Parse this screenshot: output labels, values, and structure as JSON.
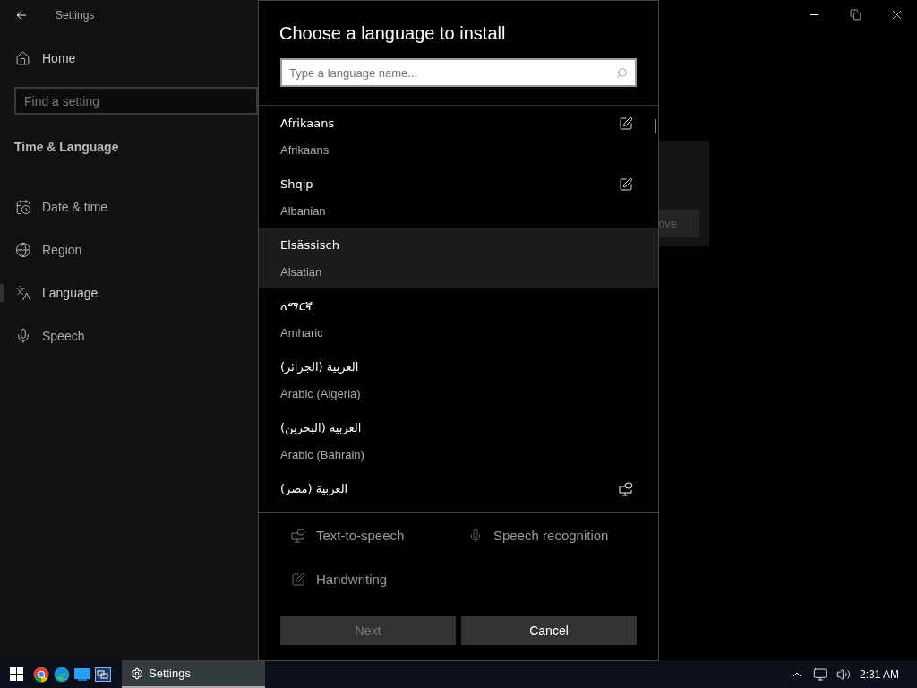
{
  "window": {
    "title": "Settings"
  },
  "sidebar": {
    "home": "Home",
    "search": {
      "placeholder": "Find a setting"
    },
    "section": "Time & Language",
    "items": [
      {
        "label": "Date & time",
        "kind": "date",
        "selected": false
      },
      {
        "label": "Region",
        "kind": "region",
        "selected": false
      },
      {
        "label": "Language",
        "kind": "language",
        "selected": true
      },
      {
        "label": "Speech",
        "kind": "speech",
        "selected": false
      }
    ]
  },
  "background_button": "ove",
  "dialog": {
    "title": "Choose a language to install",
    "search": {
      "placeholder": "Type a language name..."
    },
    "languages": [
      {
        "native": "Afrikaans",
        "english": "Afrikaans",
        "hovered": false,
        "handwriting": true,
        "text_to_speech": false
      },
      {
        "native": "Shqip",
        "english": "Albanian",
        "hovered": false,
        "handwriting": true,
        "text_to_speech": false
      },
      {
        "native": "Elsässisch",
        "english": "Alsatian",
        "hovered": true,
        "handwriting": false,
        "text_to_speech": false
      },
      {
        "native": "አማርኛ",
        "english": "Amharic",
        "hovered": false,
        "handwriting": false,
        "text_to_speech": false
      },
      {
        "native": "العربية (الجزائر)",
        "english": "Arabic (Algeria)",
        "hovered": false,
        "handwriting": false,
        "text_to_speech": false
      },
      {
        "native": "العربية (البحرين)",
        "english": "Arabic (Bahrain)",
        "hovered": false,
        "handwriting": false,
        "text_to_speech": false
      },
      {
        "native": "العربية (مصر)",
        "hovered": false,
        "handwriting": false,
        "text_to_speech": true
      }
    ],
    "legend": [
      {
        "kind": "text-to-speech",
        "label": "Text-to-speech"
      },
      {
        "kind": "speech",
        "label": "Speech recognition"
      },
      {
        "kind": "handwriting",
        "label": "Handwriting"
      }
    ],
    "buttons": [
      {
        "label": "Next",
        "disabled": true
      },
      {
        "label": "Cancel",
        "disabled": false
      }
    ]
  },
  "taskbar": {
    "apps": [
      {
        "kind": "chrome"
      },
      {
        "kind": "edge"
      },
      {
        "kind": "mail"
      },
      {
        "kind": "remote"
      }
    ],
    "active_task": "Settings",
    "time": "2:31 AM"
  }
}
